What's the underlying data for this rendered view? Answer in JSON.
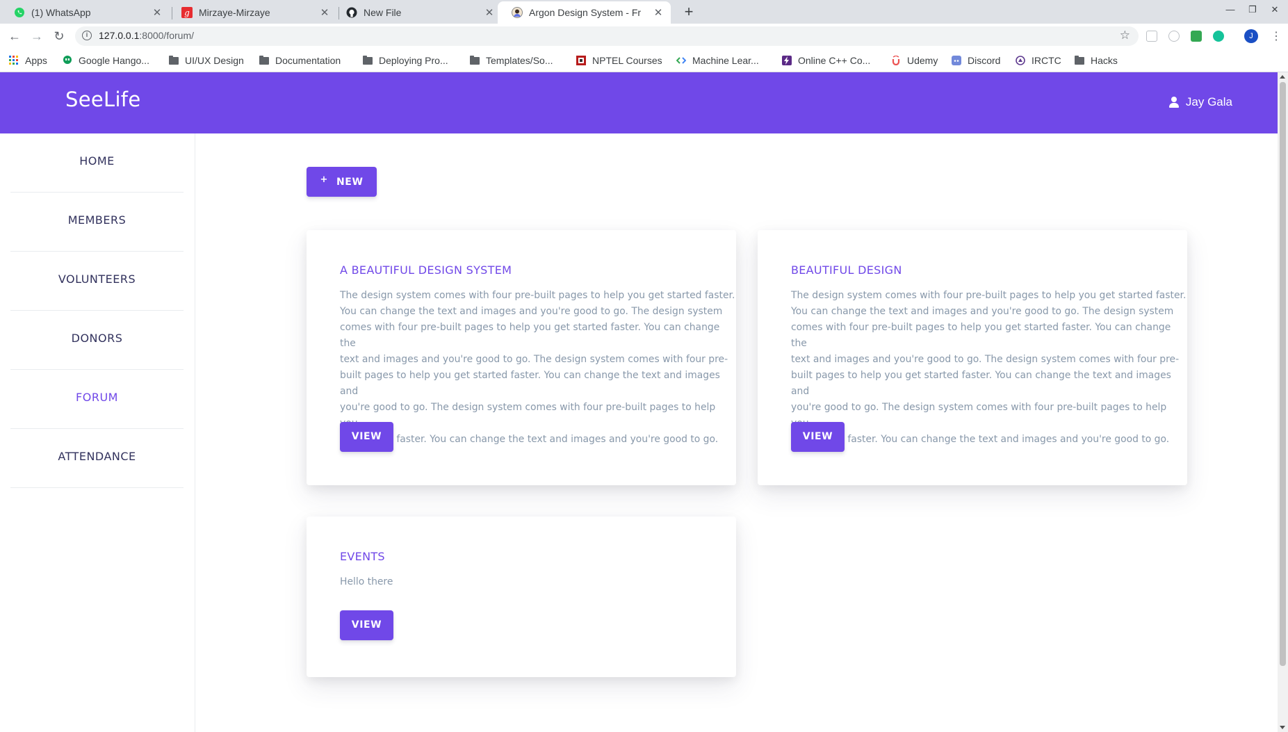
{
  "browser": {
    "tabs": [
      {
        "title": "(1) WhatsApp",
        "icon": "whatsapp-icon",
        "color": "#25d366"
      },
      {
        "title": "Mirzaye-Mirzaye",
        "icon": "gaana-icon",
        "color": "#e72c30"
      },
      {
        "title": "New File",
        "icon": "github-icon",
        "color": "#24292e"
      },
      {
        "title": "Argon Design System - Fr",
        "icon": "argon-avatar-icon",
        "color": "#5e72e4"
      }
    ],
    "new_tab_label": "+",
    "url_host": "127.0.0.1",
    "url_rest": ":8000/forum/",
    "bookmarks": [
      {
        "label": "Apps",
        "icon": "apps-grid-icon"
      },
      {
        "label": "Google Hango...",
        "icon": "hangouts-icon"
      },
      {
        "label": "UI/UX Design",
        "icon": "folder-icon"
      },
      {
        "label": "Documentation",
        "icon": "folder-icon"
      },
      {
        "label": "Deploying Pro...",
        "icon": "folder-icon"
      },
      {
        "label": "Templates/So...",
        "icon": "folder-icon"
      },
      {
        "label": "NPTEL Courses",
        "icon": "nptel-icon"
      },
      {
        "label": "Machine Lear...",
        "icon": "code-icon"
      },
      {
        "label": "Online C++ Co...",
        "icon": "bolt-icon"
      },
      {
        "label": "Udemy",
        "icon": "udemy-icon"
      },
      {
        "label": "Discord",
        "icon": "discord-icon"
      },
      {
        "label": "IRCTC",
        "icon": "irctc-icon"
      },
      {
        "label": "Hacks",
        "icon": "folder-icon"
      }
    ],
    "profile_initial": "J"
  },
  "app": {
    "brand": "SeeLife",
    "user_name": "Jay Gala",
    "accent_color": "#7048e8"
  },
  "sidebar": {
    "items": [
      {
        "label": "HOME",
        "active": false
      },
      {
        "label": "MEMBERS",
        "active": false
      },
      {
        "label": "VOLUNTEERS",
        "active": false
      },
      {
        "label": "DONORS",
        "active": false
      },
      {
        "label": "FORUM",
        "active": true
      },
      {
        "label": "ATTENDANCE",
        "active": false
      }
    ]
  },
  "main": {
    "new_button_label": "NEW",
    "cards": [
      {
        "title": "A BEAUTIFUL DESIGN SYSTEM",
        "text_lines": [
          "The design system comes with four pre-built pages to help you get started faster.",
          "You can change the text and images and you're good to go. The design system",
          "comes with four pre-built pages to help you get started faster. You can change the",
          "text and images and you're good to go. The design system comes with four pre-",
          "built pages to help you get started faster. You can change the text and images and",
          "you're good to go. The design system comes with four pre-built pages to help you",
          "get started faster. You can change the text and images and you're good to go."
        ],
        "button_label": "VIEW"
      },
      {
        "title": "BEAUTIFUL DESIGN",
        "text_lines": [
          "The design system comes with four pre-built pages to help you get started faster.",
          "You can change the text and images and you're good to go. The design system",
          "comes with four pre-built pages to help you get started faster. You can change the",
          "text and images and you're good to go. The design system comes with four pre-",
          "built pages to help you get started faster. You can change the text and images and",
          "you're good to go. The design system comes with four pre-built pages to help you",
          "get started faster. You can change the text and images and you're good to go."
        ],
        "button_label": "VIEW"
      },
      {
        "title": "EVENTS",
        "text_lines": [
          "Hello there"
        ],
        "button_label": "VIEW"
      }
    ]
  }
}
